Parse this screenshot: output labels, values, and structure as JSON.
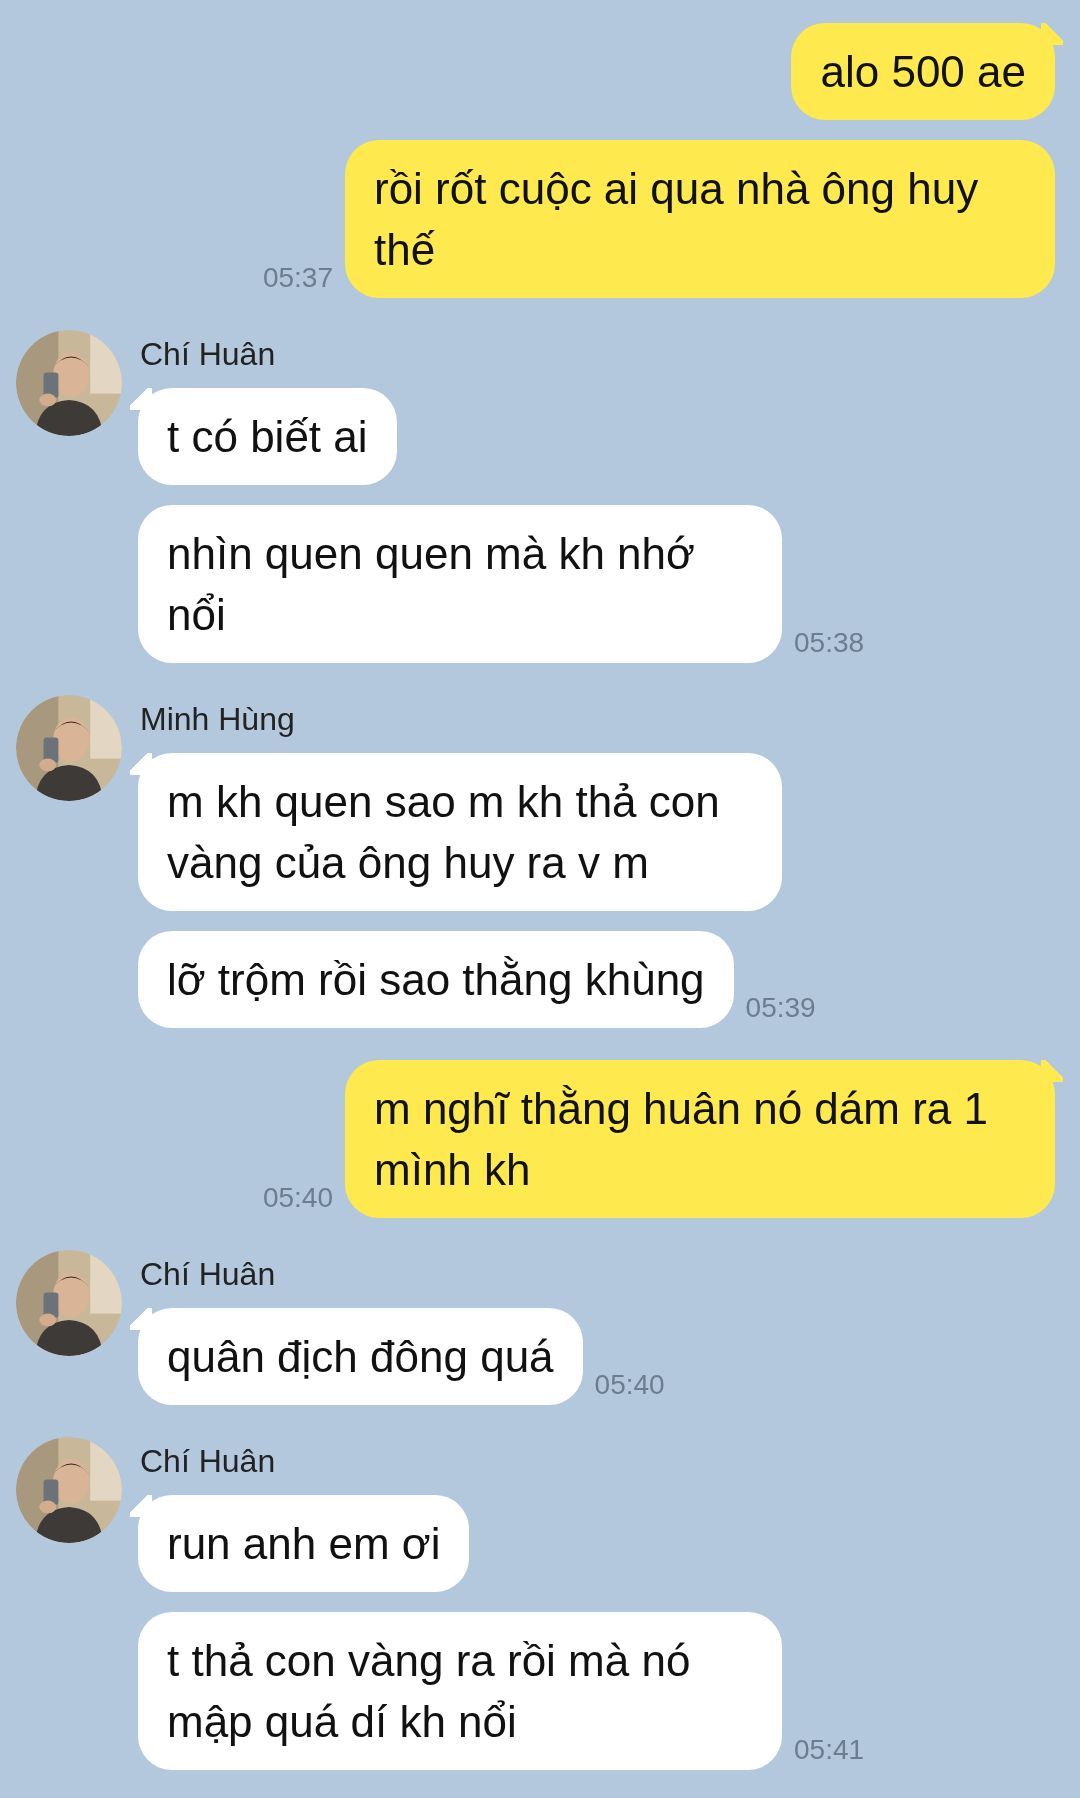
{
  "groups": [
    {
      "kind": "outgoing",
      "messages": [
        {
          "text": "alo 500 ae"
        },
        {
          "text": "rồi rốt cuộc ai qua nhà ông huy thế",
          "time": "05:37"
        }
      ]
    },
    {
      "kind": "incoming",
      "sender": "Chí Huân",
      "messages": [
        {
          "text": "t có biết ai"
        },
        {
          "text": "nhìn quen quen mà kh nhớ nổi",
          "time": "05:38"
        }
      ]
    },
    {
      "kind": "incoming",
      "sender": "Minh Hùng",
      "messages": [
        {
          "text": "m kh quen sao m kh thả con vàng của ông huy ra v m"
        },
        {
          "text": "lỡ trộm rồi sao thằng khùng",
          "time": "05:39"
        }
      ]
    },
    {
      "kind": "outgoing",
      "messages": [
        {
          "text": "m nghĩ thằng huân nó dám ra 1 mình kh",
          "time": "05:40"
        }
      ]
    },
    {
      "kind": "incoming",
      "sender": "Chí Huân",
      "messages": [
        {
          "text": "quân địch đông quá",
          "time": "05:40"
        }
      ]
    },
    {
      "kind": "incoming",
      "sender": "Chí Huân",
      "messages": [
        {
          "text": "run anh em ơi"
        },
        {
          "text": "t thả con vàng ra rồi mà nó mập quá dí kh nổi",
          "time": "05:41"
        }
      ]
    }
  ]
}
